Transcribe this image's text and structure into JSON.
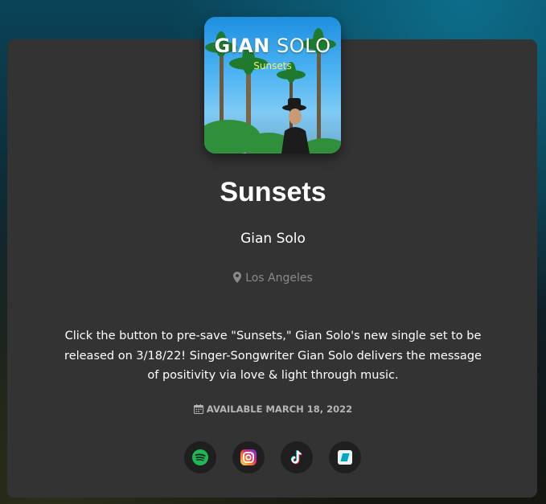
{
  "release": {
    "cover": {
      "artist_first": "GIAN",
      "artist_last": "SOLO",
      "title": "Sunsets"
    },
    "title": "Sunsets",
    "artist": "Gian Solo",
    "location": "Los Angeles",
    "description": "Click the button to pre-save \"Sunsets,\" Gian Solo's new single set to be released on 3/18/22! Singer-Songwriter Gian Solo delivers the message of positivity via love & light through music.",
    "availability": "AVAILABLE MARCH 18, 2022"
  },
  "links": [
    {
      "service": "Spotify",
      "icon": "spotify-icon",
      "color": "#1DB954"
    },
    {
      "service": "Instagram",
      "icon": "instagram-icon",
      "color": "#E1306C"
    },
    {
      "service": "TikTok",
      "icon": "tiktok-icon",
      "color": "#25F4EE"
    },
    {
      "service": "Bandsintown",
      "icon": "bandsintown-icon",
      "color": "#00CEC8"
    }
  ],
  "colors": {
    "card_background": "#333333",
    "text_primary": "#ffffff",
    "text_muted": "#8a8a8a",
    "icon_button_background": "#1f1f1f"
  }
}
